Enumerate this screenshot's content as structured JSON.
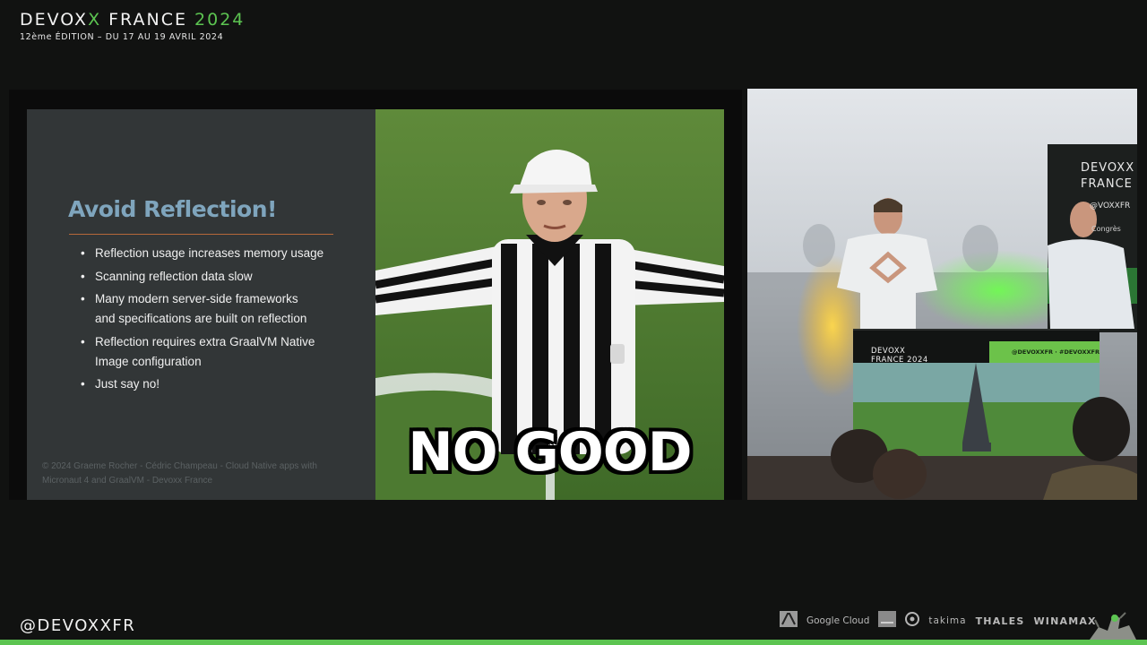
{
  "header": {
    "brand_prefix": "DEVOX",
    "brand_x": "X",
    "brand_name": " FRANCE ",
    "brand_year": "2024",
    "subtitle": "12ème ÉDITION – DU 17 AU 19 AVRIL 2024"
  },
  "slide": {
    "title": "Avoid Reflection!",
    "bullets": [
      "Reflection usage increases memory usage",
      "Scanning reflection data slow",
      "Many modern server-side frameworks and specifications are built on reflection",
      "Reflection requires extra GraalVM Native Image configuration",
      "Just say no!"
    ],
    "footer": "© 2024 Graeme Rocher - Cédric Champeau - Cloud Native apps with Micronaut 4 and GraalVM - Devoxx France",
    "accent_color": "#7fa5bd",
    "rule_color": "#b5683a"
  },
  "meme": {
    "caption": "NO GOOD",
    "icon": "referee-image"
  },
  "stage": {
    "banner_title": "DEVOXX FRANCE",
    "banner_handle": "@VOXXFR",
    "banner_congres": "Congrès",
    "screen_title": "DEVOXX FRANCE 2024",
    "screen_handle": "@DEVOXXFR · #DEVOXXFR"
  },
  "footer": {
    "handle": "@DEVOXXFR",
    "sponsors": [
      "Google Cloud",
      "takima",
      "THALES",
      "WINAMAX"
    ],
    "accent_color": "#5cc451"
  }
}
